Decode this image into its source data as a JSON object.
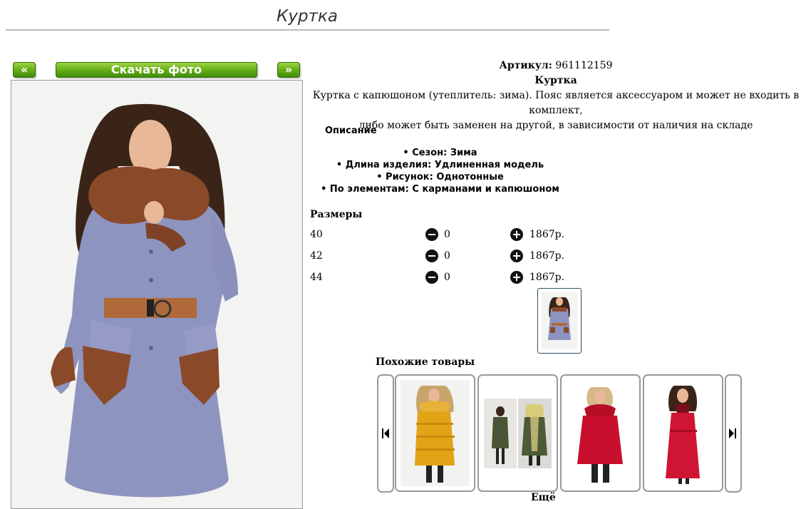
{
  "page": {
    "title": "Куртка"
  },
  "toolbar": {
    "prev_label": "«",
    "download_label": "Скачать фото",
    "next_label": "»"
  },
  "product": {
    "article_label": "Артикул:",
    "article_value": "961112159",
    "name": "Куртка",
    "desc_line1": "Куртка с капюшоном (утеплитель: зима). Пояс является аксессуаром и может не входить в комплект,",
    "desc_line2": "либо может быть заменен на другой, в зависимости от наличия на складе"
  },
  "description": {
    "heading": "Описание",
    "features": [
      "• Сезон: Зима",
      "• Длина изделия: Удлиненная модель",
      "• Рисунок: Однотонные",
      "• По элементам: С карманами и капюшоном"
    ]
  },
  "sizes": {
    "heading": "Размеры",
    "rows": [
      {
        "size": "40",
        "qty": "0",
        "price": "1867р."
      },
      {
        "size": "42",
        "qty": "0",
        "price": "1867р."
      },
      {
        "size": "44",
        "qty": "0",
        "price": "1867р."
      }
    ]
  },
  "similar": {
    "heading": "Похожие товары",
    "more_partial": "Ещё"
  },
  "icons": {
    "prev": "chevron-double-left-icon",
    "next": "chevron-double-right-icon",
    "minus": "minus-circle-icon",
    "plus": "plus-circle-icon",
    "carousel_prev": "skip-back-icon",
    "carousel_next": "skip-forward-icon"
  },
  "colors": {
    "button_green": "#5aa515",
    "coat_main": "#8e94c0",
    "fur_brown": "#8a4a2a",
    "belt": "#b06a3a",
    "mustard": "#e2a417",
    "olive": "#4a5535",
    "red": "#c8102e"
  }
}
